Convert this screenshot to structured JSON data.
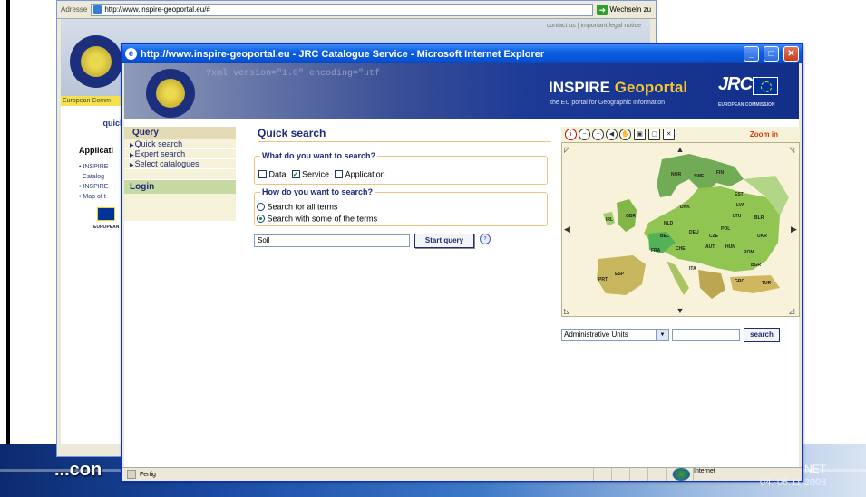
{
  "back_window": {
    "address_label": "Adresse",
    "address_url": "http://www.inspire-geoportal.eu/#",
    "go_label": "Wechseln zu",
    "top_links": "contact us | important legal notice",
    "yellow_bar": "European Comm",
    "quick": "quick",
    "applications": "Applicati",
    "list": [
      "INSPIRE",
      "Catalog",
      "INSPIRE",
      "Map of t"
    ],
    "eu_label": "EUROPEAN C"
  },
  "front_window": {
    "title": "http://www.inspire-geoportal.eu - JRC Catalogue Service - Microsoft Internet Explorer",
    "buttons": {
      "minimize": "_",
      "maximize": "□",
      "close": "✕"
    },
    "banner": {
      "xml_text": "?xml version=\"1.0\" encoding=\"utf",
      "title_a": "INSPIRE",
      "title_b": "Geoportal",
      "subtitle": "the EU portal for Geographic Information",
      "jrc": "JRC",
      "eu_commission": "EUROPEAN COMMISSION"
    },
    "sidebar": {
      "header": "Query",
      "items": [
        "Quick search",
        "Expert search",
        "Select catalogues"
      ],
      "login": "Login"
    },
    "main": {
      "title": "Quick search",
      "what_legend": "What do you want to search?",
      "what_options": [
        {
          "label": "Data",
          "checked": false
        },
        {
          "label": "Service",
          "checked": true
        },
        {
          "label": "Application",
          "checked": false
        }
      ],
      "how_legend": "How do you want to search?",
      "how_options": [
        {
          "label": "Search for all terms",
          "selected": false
        },
        {
          "label": "Search with some of the terms",
          "selected": true
        }
      ],
      "query_value": "Soil",
      "start_button": "Start query",
      "help_icon_text": "?"
    },
    "map": {
      "zoom_label": "Zoom in",
      "select_value": "Administrative Units",
      "search_button": "search",
      "country_labels": [
        "NOR",
        "SWE",
        "FIN",
        "EST",
        "LVA",
        "LTU",
        "BLR",
        "POL",
        "UKR",
        "DEU",
        "FRA",
        "ESP",
        "ITA",
        "GBR",
        "IRL",
        "PRT",
        "ROM",
        "BGR",
        "GRC",
        "TUR",
        "HUN",
        "AUT",
        "CZE",
        "DNK",
        "NLD",
        "BEL",
        "CHE"
      ]
    },
    "status": {
      "left": "Fertig",
      "zone": "Internet"
    }
  },
  "slide": {
    "bottom_text": "...con",
    "right_a": "NET",
    "right_b": "04.-05.11.2008"
  },
  "colors": {
    "banner_blue": "#12308a",
    "sidebar_green": "#c6d9a3",
    "accent_orange": "#f1c27d",
    "title_blue": "#1f2a7a"
  }
}
